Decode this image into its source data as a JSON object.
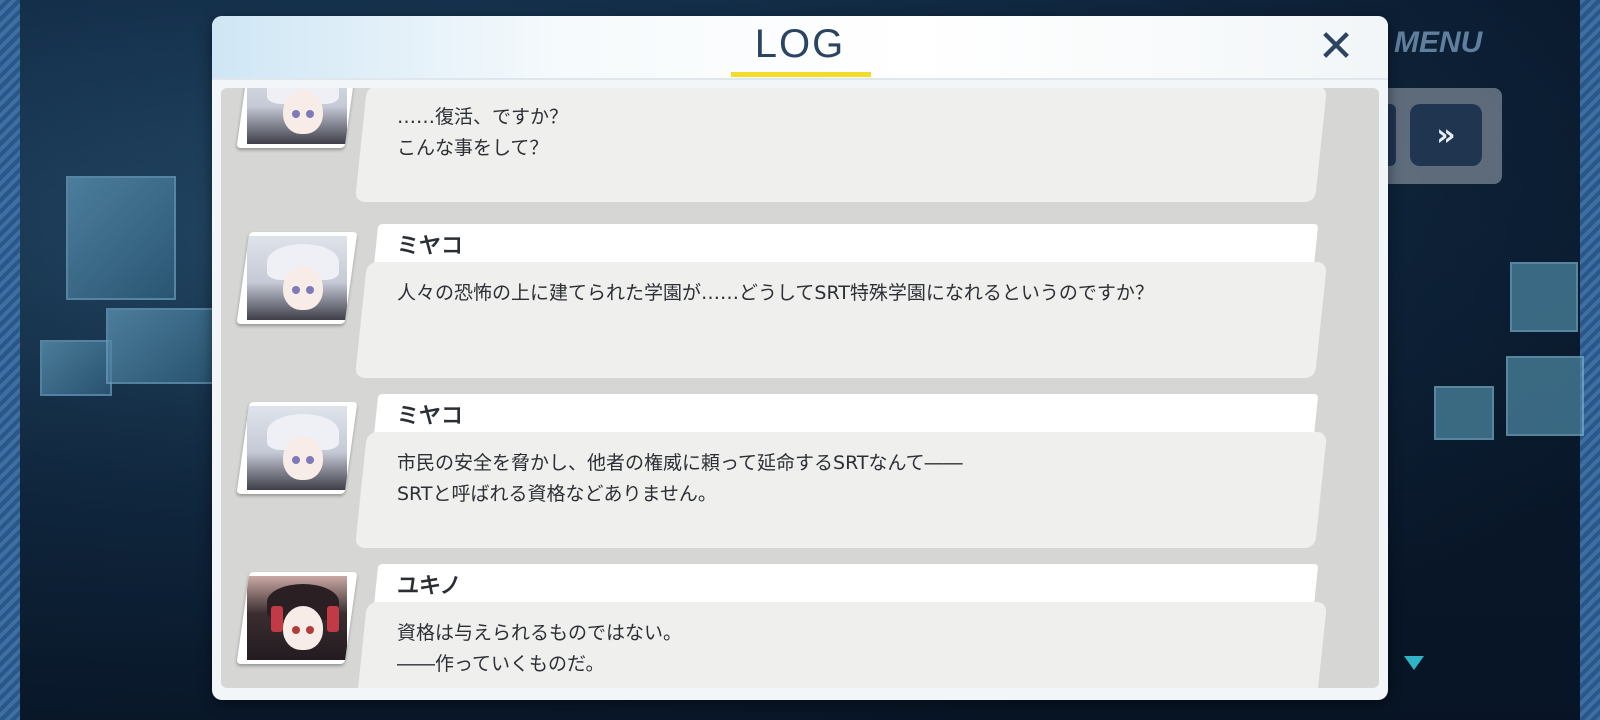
{
  "header": {
    "title": "LOG",
    "close_icon": "close-icon"
  },
  "game_ui": {
    "menu_label": "MENU",
    "fast_forward_glyph": "»"
  },
  "entries": [
    {
      "speaker": "",
      "portrait": "miyako-portrait",
      "text": "……復活、ですか？\nこんな事をして？"
    },
    {
      "speaker": "ミヤコ",
      "portrait": "miyako-portrait",
      "text": "人々の恐怖の上に建てられた学園が……どうしてSRT特殊学園になれるというのですか？"
    },
    {
      "speaker": "ミヤコ",
      "portrait": "miyako-portrait",
      "text": "市民の安全を脅かし、他者の権威に頼って延命するSRTなんて――\nSRTと呼ばれる資格などありません。"
    },
    {
      "speaker": "ユキノ",
      "portrait": "yukino-portrait",
      "text": "資格は与えられるものではない。\n――作っていくものだ。"
    }
  ],
  "colors": {
    "title": "#2b4462",
    "underline": "#f4dd2a",
    "bubble": "#efefed",
    "log_bg": "#d6d7d4"
  }
}
